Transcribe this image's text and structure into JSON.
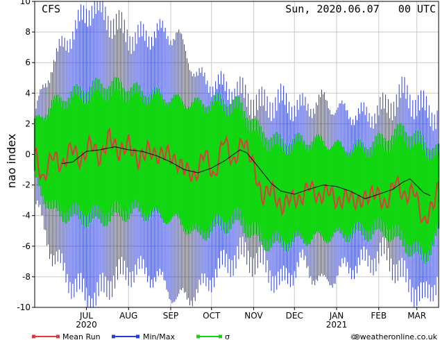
{
  "header": {
    "model": "CFS",
    "run": "Sun, 2020.06.07   00 UTC"
  },
  "credit": "© weatheronline.co.uk",
  "colors": {
    "mean": "#e03a3a",
    "minmax": "#2b3cd6",
    "sigma": "#11d611",
    "ensemble": "#000000",
    "grid": "#c8c8c8"
  },
  "chart_data": {
    "type": "line",
    "title": "",
    "xlabel": "",
    "ylabel": "nao index",
    "ylim": [
      -10,
      10
    ],
    "yticks": [
      -10,
      -8,
      -6,
      -4,
      -2,
      0,
      2,
      4,
      6,
      8,
      10
    ],
    "x_start": "2020-06-07",
    "x_end": "2021-03-31",
    "month_ticks": [
      {
        "label": "JUL",
        "year": "2020",
        "date": "2020-07-15"
      },
      {
        "label": "AUG",
        "year": "",
        "date": "2020-08-15"
      },
      {
        "label": "SEP",
        "year": "",
        "date": "2020-09-15"
      },
      {
        "label": "OCT",
        "year": "",
        "date": "2020-10-15"
      },
      {
        "label": "NOV",
        "year": "",
        "date": "2020-11-15"
      },
      {
        "label": "DEC",
        "year": "",
        "date": "2020-12-15"
      },
      {
        "label": "JAN",
        "year": "2021",
        "date": "2021-01-15"
      },
      {
        "label": "FEB",
        "year": "",
        "date": "2021-02-15"
      },
      {
        "label": "MAR",
        "year": "",
        "date": "2021-03-15"
      }
    ],
    "gridlines": true,
    "legend_position": "bottom-left",
    "series": [
      {
        "name": "Mean Run",
        "color": "#e03a3a",
        "points": [
          [
            "2020-06-07",
            0.2
          ],
          [
            "2020-06-13",
            -1.8
          ],
          [
            "2020-06-20",
            0.1
          ],
          [
            "2020-06-27",
            -0.9
          ],
          [
            "2020-07-04",
            0.6
          ],
          [
            "2020-07-11",
            -0.6
          ],
          [
            "2020-07-18",
            0.9
          ],
          [
            "2020-07-25",
            -0.4
          ],
          [
            "2020-08-01",
            1.3
          ],
          [
            "2020-08-08",
            0.0
          ],
          [
            "2020-08-15",
            0.8
          ],
          [
            "2020-08-22",
            -0.5
          ],
          [
            "2020-08-29",
            0.4
          ],
          [
            "2020-09-05",
            -0.2
          ],
          [
            "2020-09-12",
            0.2
          ],
          [
            "2020-09-19",
            -0.6
          ],
          [
            "2020-09-26",
            -0.9
          ],
          [
            "2020-10-03",
            -1.6
          ],
          [
            "2020-10-10",
            0.3
          ],
          [
            "2020-10-17",
            -1.7
          ],
          [
            "2020-10-24",
            1.2
          ],
          [
            "2020-10-31",
            -0.7
          ],
          [
            "2020-11-07",
            1.0
          ],
          [
            "2020-11-14",
            -0.4
          ],
          [
            "2020-11-21",
            -2.9
          ],
          [
            "2020-11-28",
            -2.1
          ],
          [
            "2020-12-05",
            -3.6
          ],
          [
            "2020-12-12",
            -2.7
          ],
          [
            "2020-12-19",
            -3.1
          ],
          [
            "2020-12-26",
            -1.9
          ],
          [
            "2021-01-02",
            -3.0
          ],
          [
            "2021-01-09",
            -2.2
          ],
          [
            "2021-01-16",
            -3.3
          ],
          [
            "2021-01-23",
            -2.6
          ],
          [
            "2021-01-30",
            -3.2
          ],
          [
            "2021-02-06",
            -2.8
          ],
          [
            "2021-02-13",
            -2.4
          ],
          [
            "2021-02-20",
            -3.5
          ],
          [
            "2021-02-27",
            -1.6
          ],
          [
            "2021-03-06",
            -2.9
          ],
          [
            "2021-03-13",
            -2.2
          ],
          [
            "2021-03-20",
            -4.6
          ],
          [
            "2021-03-27",
            -3.2
          ],
          [
            "2021-03-31",
            -2.1
          ]
        ]
      },
      {
        "name": "Min/Max",
        "color": "#2b3cd6",
        "upper_points": [
          [
            "2020-06-07",
            2.5
          ],
          [
            "2020-06-20",
            6.0
          ],
          [
            "2020-07-05",
            8.0
          ],
          [
            "2020-07-20",
            9.8
          ],
          [
            "2020-08-05",
            8.5
          ],
          [
            "2020-08-20",
            7.5
          ],
          [
            "2020-09-05",
            8.0
          ],
          [
            "2020-09-20",
            7.8
          ],
          [
            "2020-10-05",
            5.0
          ],
          [
            "2020-10-20",
            4.5
          ],
          [
            "2020-11-05",
            4.0
          ],
          [
            "2020-11-20",
            3.2
          ],
          [
            "2020-12-05",
            3.5
          ],
          [
            "2020-12-20",
            3.0
          ],
          [
            "2021-01-05",
            3.5
          ],
          [
            "2021-01-20",
            2.8
          ],
          [
            "2021-02-05",
            2.5
          ],
          [
            "2021-02-20",
            3.0
          ],
          [
            "2021-03-05",
            4.0
          ],
          [
            "2021-03-20",
            3.0
          ],
          [
            "2021-03-31",
            2.5
          ]
        ],
        "lower_points": [
          [
            "2020-06-07",
            -3.0
          ],
          [
            "2020-06-20",
            -6.5
          ],
          [
            "2020-07-05",
            -8.5
          ],
          [
            "2020-07-20",
            -9.5
          ],
          [
            "2020-08-05",
            -8.0
          ],
          [
            "2020-08-20",
            -7.5
          ],
          [
            "2020-09-05",
            -8.0
          ],
          [
            "2020-09-20",
            -9.5
          ],
          [
            "2020-10-05",
            -9.0
          ],
          [
            "2020-10-20",
            -7.5
          ],
          [
            "2020-11-05",
            -6.5
          ],
          [
            "2020-11-20",
            -7.0
          ],
          [
            "2020-12-05",
            -8.5
          ],
          [
            "2020-12-20",
            -7.0
          ],
          [
            "2021-01-05",
            -8.5
          ],
          [
            "2021-01-20",
            -7.5
          ],
          [
            "2021-02-05",
            -7.0
          ],
          [
            "2021-02-20",
            -6.5
          ],
          [
            "2021-03-05",
            -8.0
          ],
          [
            "2021-03-20",
            -9.5
          ],
          [
            "2021-03-31",
            -8.0
          ]
        ]
      },
      {
        "name": "σ",
        "color": "#11d611",
        "upper_points": [
          [
            "2020-06-07",
            2.0
          ],
          [
            "2020-06-20",
            3.2
          ],
          [
            "2020-07-05",
            3.8
          ],
          [
            "2020-07-20",
            4.2
          ],
          [
            "2020-08-05",
            4.3
          ],
          [
            "2020-08-20",
            4.0
          ],
          [
            "2020-09-05",
            3.8
          ],
          [
            "2020-09-20",
            3.5
          ],
          [
            "2020-10-05",
            3.2
          ],
          [
            "2020-10-20",
            3.4
          ],
          [
            "2020-11-05",
            3.0
          ],
          [
            "2020-11-20",
            1.2
          ],
          [
            "2020-12-05",
            0.6
          ],
          [
            "2020-12-20",
            0.8
          ],
          [
            "2021-01-05",
            0.8
          ],
          [
            "2021-01-20",
            0.4
          ],
          [
            "2021-02-05",
            0.4
          ],
          [
            "2021-02-20",
            0.8
          ],
          [
            "2021-03-05",
            1.4
          ],
          [
            "2021-03-20",
            0.6
          ],
          [
            "2021-03-31",
            0.0
          ]
        ],
        "lower_points": [
          [
            "2020-06-07",
            -1.6
          ],
          [
            "2020-06-20",
            -3.6
          ],
          [
            "2020-07-05",
            -3.9
          ],
          [
            "2020-07-20",
            -4.1
          ],
          [
            "2020-08-05",
            -3.8
          ],
          [
            "2020-08-20",
            -3.6
          ],
          [
            "2020-09-05",
            -4.0
          ],
          [
            "2020-09-20",
            -4.3
          ],
          [
            "2020-10-05",
            -5.2
          ],
          [
            "2020-10-20",
            -4.6
          ],
          [
            "2020-11-05",
            -4.2
          ],
          [
            "2020-11-20",
            -5.5
          ],
          [
            "2020-12-05",
            -5.8
          ],
          [
            "2020-12-20",
            -5.5
          ],
          [
            "2021-01-05",
            -5.4
          ],
          [
            "2021-01-20",
            -5.2
          ],
          [
            "2021-02-05",
            -5.0
          ],
          [
            "2021-02-20",
            -4.8
          ],
          [
            "2021-03-05",
            -5.6
          ],
          [
            "2021-03-20",
            -6.8
          ],
          [
            "2021-03-31",
            -5.0
          ]
        ]
      },
      {
        "name": "",
        "color": "#000000",
        "points": [
          [
            "2020-06-27",
            -0.6
          ],
          [
            "2020-07-05",
            -0.5
          ],
          [
            "2020-07-15",
            0.2
          ],
          [
            "2020-07-25",
            0.3
          ],
          [
            "2020-08-05",
            0.5
          ],
          [
            "2020-08-15",
            0.3
          ],
          [
            "2020-08-25",
            0.2
          ],
          [
            "2020-09-05",
            -0.1
          ],
          [
            "2020-09-15",
            -0.5
          ],
          [
            "2020-09-25",
            -1.0
          ],
          [
            "2020-10-05",
            -1.2
          ],
          [
            "2020-10-15",
            -0.9
          ],
          [
            "2020-10-25",
            -0.4
          ],
          [
            "2020-11-05",
            0.3
          ],
          [
            "2020-11-10",
            0.1
          ],
          [
            "2020-11-20",
            -1.0
          ],
          [
            "2020-11-28",
            -1.9
          ],
          [
            "2020-12-05",
            -2.4
          ],
          [
            "2020-12-15",
            -2.6
          ],
          [
            "2020-12-25",
            -2.3
          ],
          [
            "2021-01-05",
            -2.0
          ],
          [
            "2021-01-15",
            -2.1
          ],
          [
            "2021-01-25",
            -2.4
          ],
          [
            "2021-02-05",
            -2.9
          ],
          [
            "2021-02-15",
            -2.6
          ],
          [
            "2021-02-25",
            -2.3
          ],
          [
            "2021-03-05",
            -1.8
          ],
          [
            "2021-03-10",
            -1.6
          ],
          [
            "2021-03-20",
            -2.5
          ],
          [
            "2021-03-25",
            -2.7
          ]
        ]
      }
    ]
  }
}
